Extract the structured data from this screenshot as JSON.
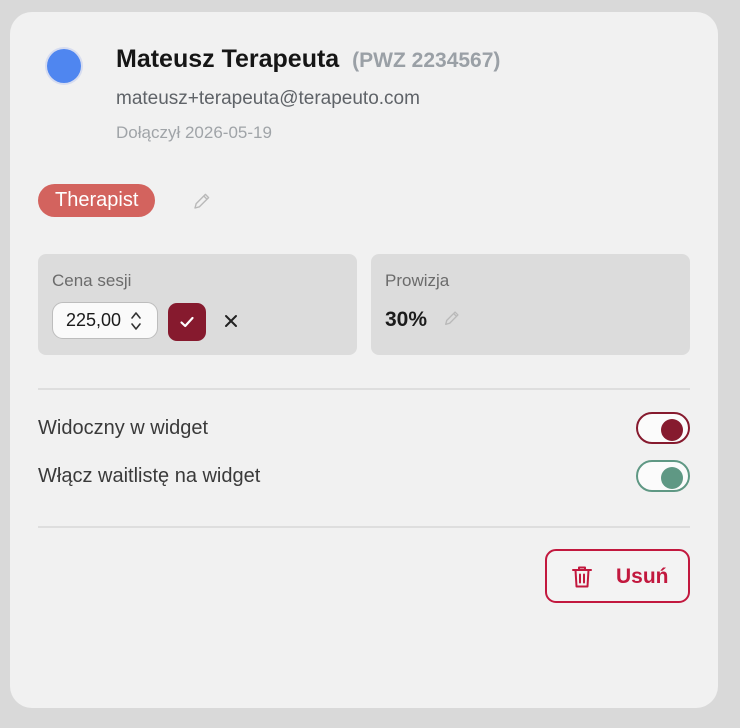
{
  "user": {
    "name": "Mateusz Terapeuta",
    "pwz": "(PWZ 2234567)",
    "email": "mateusz+terapeuta@terapeuto.com",
    "joined": "Dołączył 2026-05-19",
    "avatar_color": "#4f86f0"
  },
  "role": {
    "label": "Therapist",
    "color": "#d3635e",
    "edit_icon": "pencil-icon"
  },
  "session_price": {
    "label": "Cena sesji",
    "value": "225,00",
    "confirm_icon": "check-icon",
    "cancel_icon": "close-icon",
    "confirm_color": "#861a2e"
  },
  "commission": {
    "label": "Prowizja",
    "value": "30%",
    "edit_icon": "pencil-icon"
  },
  "toggles": [
    {
      "label": "Widoczny w widget",
      "on": true,
      "color": "#861a2e"
    },
    {
      "label": "Włącz waitlistę na widget",
      "on": true,
      "color": "#5f9884"
    }
  ],
  "delete_button": {
    "label": "Usuń",
    "icon": "trash-icon",
    "color": "#c2183e"
  }
}
